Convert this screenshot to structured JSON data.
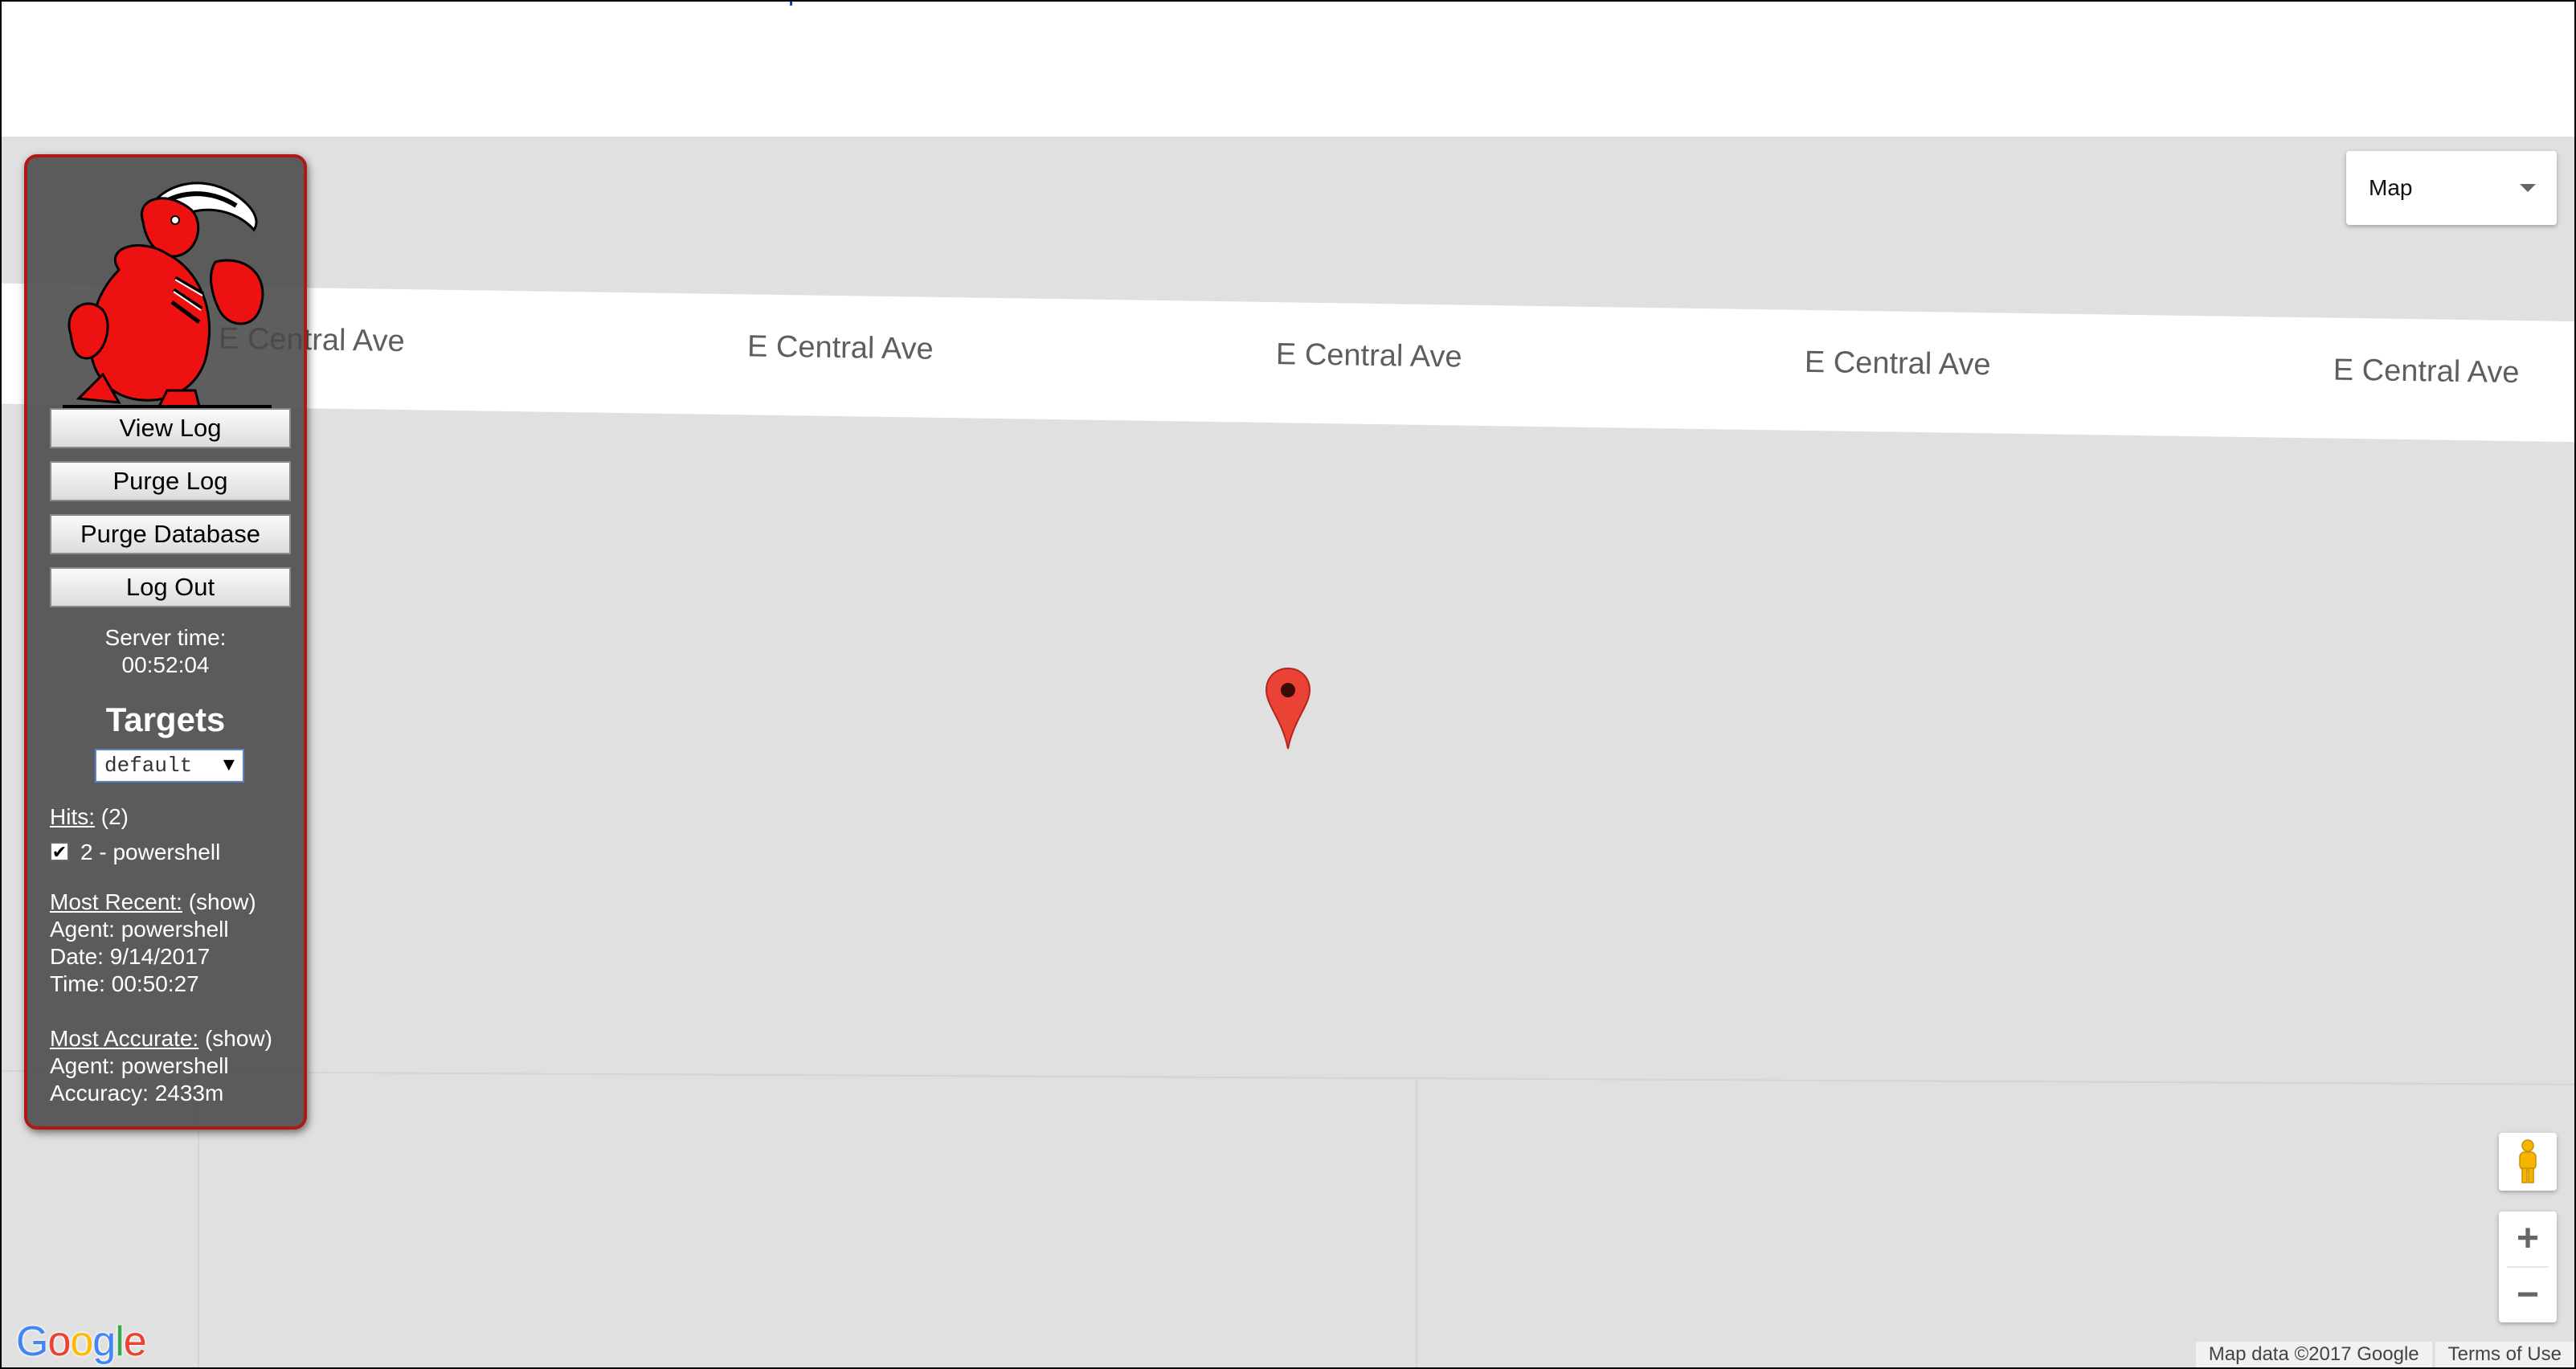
{
  "map": {
    "road_labels": [
      "E Central Ave",
      "E Central Ave",
      "E Central Ave",
      "E Central Ave",
      "E Central Ave"
    ],
    "map_type": "Map",
    "attribution": {
      "map_data": "Map data ©2017 Google",
      "terms": "Terms of Use"
    },
    "google_letters": [
      "G",
      "o",
      "o",
      "g",
      "l",
      "e"
    ],
    "google_colors": [
      "#4285F4",
      "#EA4335",
      "#FBBC05",
      "#4285F4",
      "#34A853",
      "#EA4335"
    ],
    "zoom_in": "+",
    "zoom_out": "−",
    "marker_color": "#EA4335"
  },
  "panel": {
    "buttons": [
      "View Log",
      "Purge Log",
      "Purge Database",
      "Log Out"
    ],
    "server_time_label": "Server time:",
    "server_time": "00:52:04",
    "targets_title": "Targets",
    "target_selected": "default",
    "hits_label": "Hits:",
    "hits_count": "(2)",
    "hit_item": "2 - powershell",
    "most_recent": {
      "label": "Most Recent:",
      "toggle": "(show)",
      "agent": "Agent: powershell",
      "date": "Date: 9/14/2017",
      "time": "Time: 00:50:27"
    },
    "most_accurate": {
      "label": "Most Accurate:",
      "toggle": "(show)",
      "agent": "Agent: powershell",
      "accuracy": "Accuracy: 2433m"
    },
    "border_color": "#B01818"
  }
}
